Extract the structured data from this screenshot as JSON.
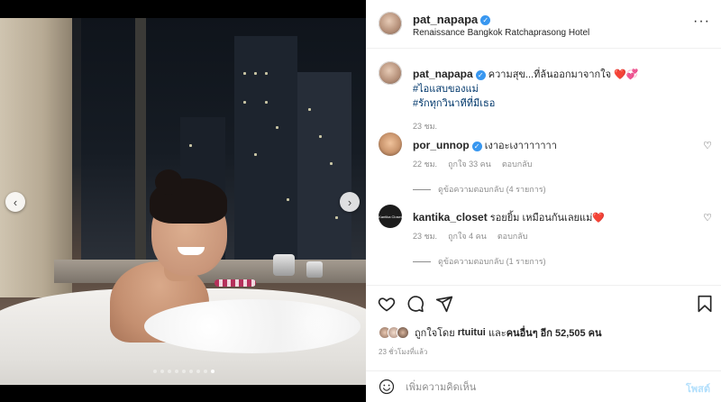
{
  "post": {
    "username": "pat_napapa",
    "location": "Renaissance Bangkok Ratchaprasong Hotel",
    "more_icon": "more-horizontal-icon"
  },
  "media": {
    "carousel_total": 9,
    "carousel_active_index": 8
  },
  "caption": {
    "username": "pat_napapa",
    "text": "ความสุข...ที่ล้นออกมาจากใจ",
    "emoji": "❤️💞",
    "hashtags": [
      "#ไอแสบของแม่",
      "#รักทุกวินาทีที่มีเธอ"
    ],
    "time": "23 ชม."
  },
  "comments": [
    {
      "username": "por_unnop",
      "verified": true,
      "text": "เงาอะเงาาาาาาา",
      "time": "22 ชม.",
      "likes": "ถูกใจ 33 คน",
      "reply_label": "ตอบกลับ",
      "view_replies": "ดูข้อความตอบกลับ (4 รายการ)"
    },
    {
      "username": "kantika_closet",
      "verified": false,
      "text": "รอยยิ้ม เหมือนกันเลยแม่",
      "emoji": "❤️",
      "time": "23 ชม.",
      "likes": "ถูกใจ 4 คน",
      "reply_label": "ตอบกลับ",
      "view_replies": "ดูข้อความตอบกลับ (1 รายการ)",
      "avatar_text": "Kantika Closet"
    }
  ],
  "actions": {
    "like_icon": "heart-icon",
    "comment_icon": "comment-icon",
    "share_icon": "send-icon",
    "save_icon": "bookmark-icon",
    "liked_by_prefix": "ถูกใจโดย",
    "liked_by_user": "rtuitui",
    "liked_by_and": "และ",
    "liked_by_others": "คนอื่นๆ อีก 52,505 คน",
    "timestamp": "23 ชั่วโมงที่แล้ว"
  },
  "add_comment": {
    "placeholder": "เพิ่มความคิดเห็น",
    "post_label": "โพสต์",
    "emoji_icon": "smiley-icon"
  },
  "colors": {
    "verified": "#3897f0",
    "heart_emoji": "#d4173f",
    "hashtag": "#00376b",
    "post_button_disabled": "#b2dffc"
  }
}
